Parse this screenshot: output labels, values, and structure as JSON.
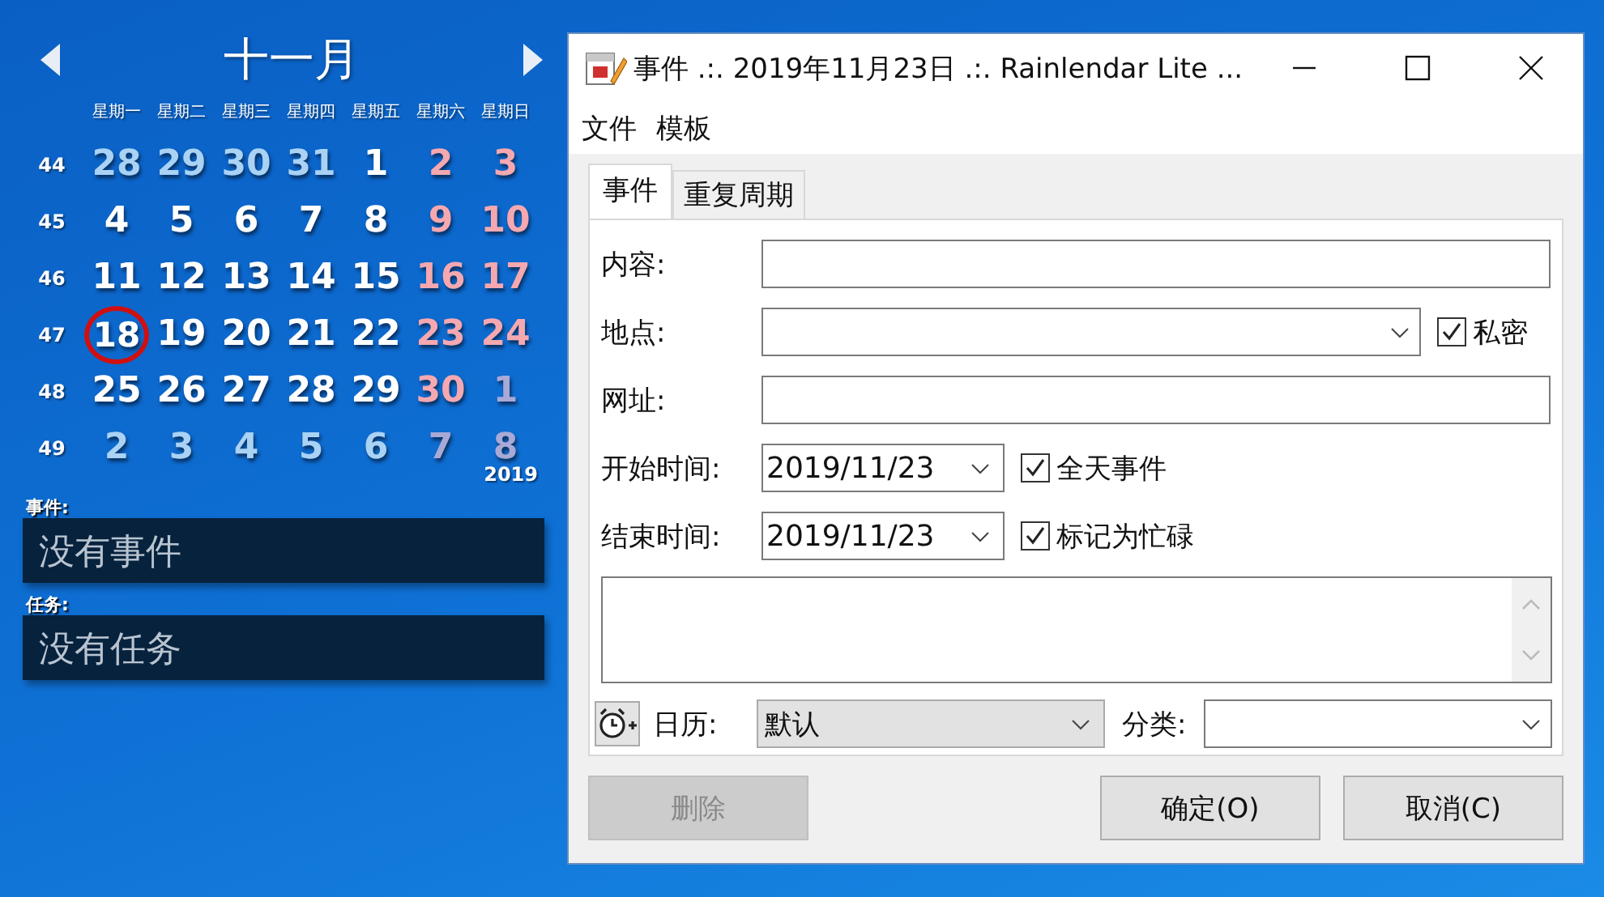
{
  "calendar": {
    "month": "十一月",
    "weekdays": [
      "星期一",
      "星期二",
      "星期三",
      "星期四",
      "星期五",
      "星期六",
      "星期日"
    ],
    "weeks": [
      {
        "number": "44",
        "days": [
          {
            "label": "28",
            "kind": "other",
            "today": false
          },
          {
            "label": "29",
            "kind": "other",
            "today": false
          },
          {
            "label": "30",
            "kind": "other",
            "today": false
          },
          {
            "label": "31",
            "kind": "other",
            "today": false
          },
          {
            "label": "1",
            "kind": "normal",
            "today": false
          },
          {
            "label": "2",
            "kind": "weekend",
            "today": false
          },
          {
            "label": "3",
            "kind": "weekend",
            "today": false
          }
        ]
      },
      {
        "number": "45",
        "days": [
          {
            "label": "4",
            "kind": "normal",
            "today": false
          },
          {
            "label": "5",
            "kind": "normal",
            "today": false
          },
          {
            "label": "6",
            "kind": "normal",
            "today": false
          },
          {
            "label": "7",
            "kind": "normal",
            "today": false
          },
          {
            "label": "8",
            "kind": "normal",
            "today": false
          },
          {
            "label": "9",
            "kind": "weekend",
            "today": false
          },
          {
            "label": "10",
            "kind": "weekend",
            "today": false
          }
        ]
      },
      {
        "number": "46",
        "days": [
          {
            "label": "11",
            "kind": "normal",
            "today": false
          },
          {
            "label": "12",
            "kind": "normal",
            "today": false
          },
          {
            "label": "13",
            "kind": "normal",
            "today": false
          },
          {
            "label": "14",
            "kind": "normal",
            "today": false
          },
          {
            "label": "15",
            "kind": "normal",
            "today": false
          },
          {
            "label": "16",
            "kind": "weekend",
            "today": false
          },
          {
            "label": "17",
            "kind": "weekend",
            "today": false
          }
        ]
      },
      {
        "number": "47",
        "days": [
          {
            "label": "18",
            "kind": "normal",
            "today": true
          },
          {
            "label": "19",
            "kind": "normal",
            "today": false
          },
          {
            "label": "20",
            "kind": "normal",
            "today": false
          },
          {
            "label": "21",
            "kind": "normal",
            "today": false
          },
          {
            "label": "22",
            "kind": "normal",
            "today": false
          },
          {
            "label": "23",
            "kind": "weekend",
            "today": false
          },
          {
            "label": "24",
            "kind": "weekend",
            "today": false
          }
        ]
      },
      {
        "number": "48",
        "days": [
          {
            "label": "25",
            "kind": "normal",
            "today": false
          },
          {
            "label": "26",
            "kind": "normal",
            "today": false
          },
          {
            "label": "27",
            "kind": "normal",
            "today": false
          },
          {
            "label": "28",
            "kind": "normal",
            "today": false
          },
          {
            "label": "29",
            "kind": "normal",
            "today": false
          },
          {
            "label": "30",
            "kind": "weekend",
            "today": false
          },
          {
            "label": "1",
            "kind": "other_weekend",
            "today": false
          }
        ]
      },
      {
        "number": "49",
        "days": [
          {
            "label": "2",
            "kind": "other",
            "today": false
          },
          {
            "label": "3",
            "kind": "other",
            "today": false
          },
          {
            "label": "4",
            "kind": "other",
            "today": false
          },
          {
            "label": "5",
            "kind": "other",
            "today": false
          },
          {
            "label": "6",
            "kind": "other",
            "today": false
          },
          {
            "label": "7",
            "kind": "other_weekend",
            "today": false
          },
          {
            "label": "8",
            "kind": "other_weekend",
            "today": false
          }
        ]
      }
    ],
    "year": "2019"
  },
  "panels": [
    {
      "label": "事件:",
      "text": "没有事件"
    },
    {
      "label": "任务:",
      "text": "没有任务"
    }
  ],
  "dialog": {
    "title": "事件 .:. 2019年11月23日 .:. Rainlendar Lite ...",
    "menu": [
      "文件",
      "模板"
    ],
    "tabs": [
      {
        "label": "事件",
        "selected": true
      },
      {
        "label": "重复周期",
        "selected": false
      }
    ],
    "rows": [
      {
        "label": "内容:",
        "kind": "text"
      },
      {
        "label": "地点:",
        "kind": "combo",
        "checkbox": {
          "label": "私密",
          "checked": true
        }
      },
      {
        "label": "网址:",
        "kind": "text"
      },
      {
        "label": "开始时间:",
        "kind": "date",
        "value": "2019/11/23",
        "checkbox": {
          "label": "全天事件",
          "checked": true
        }
      },
      {
        "label": "结束时间:",
        "kind": "date",
        "value": "2019/11/23",
        "checkbox": {
          "label": "标记为忙碌",
          "checked": true
        }
      }
    ],
    "calendar_label": "日历:",
    "calendar_value": "默认",
    "category_label": "分类:",
    "buttons": [
      {
        "label": "删除",
        "disabled": true
      },
      {
        "label": "确定(O)",
        "disabled": false
      },
      {
        "label": "取消(C)",
        "disabled": false
      }
    ]
  }
}
